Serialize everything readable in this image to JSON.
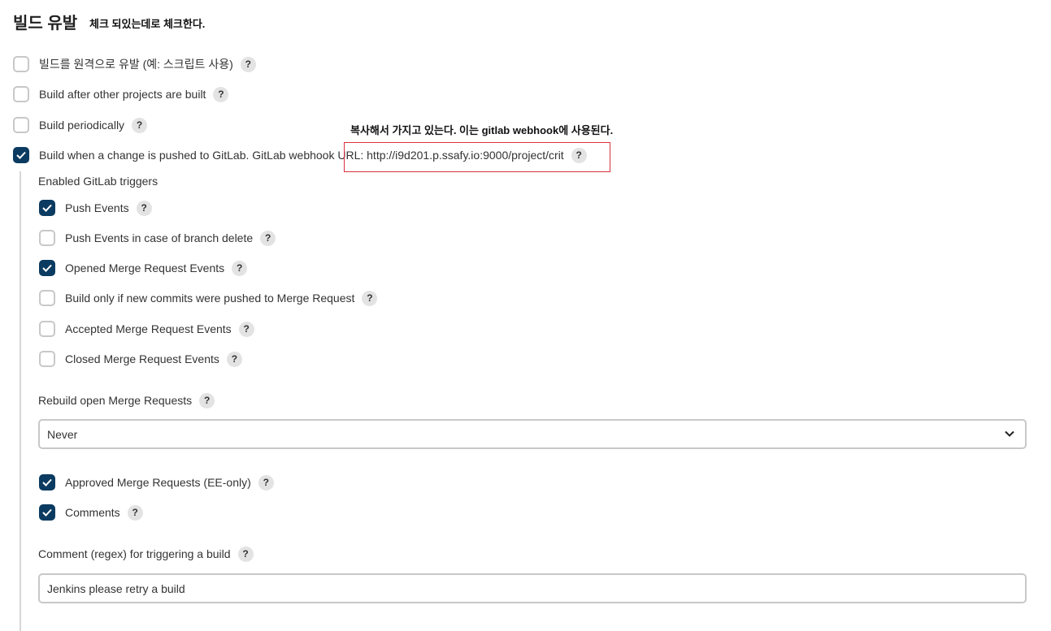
{
  "section": {
    "title": "빌드 유발",
    "annotation_top": "체크 되있는데로 체크한다."
  },
  "annotation_url": "복사해서 가지고 있는다. 이는 gitlab webhook에 사용된다.",
  "help_glyph": "?",
  "triggers": [
    {
      "label": "빌드를 원격으로 유발 (예: 스크립트 사용)",
      "checked": false
    },
    {
      "label": "Build after other projects are built",
      "checked": false
    },
    {
      "label": "Build periodically",
      "checked": false
    },
    {
      "label": "Build when a change is pushed to GitLab. GitLab webhook URL: http://i9d201.p.ssafy.io:9000/project/crit",
      "checked": true
    }
  ],
  "gitlab": {
    "enabled_triggers_label": "Enabled GitLab triggers",
    "events": [
      {
        "label": "Push Events",
        "checked": true
      },
      {
        "label": "Push Events in case of branch delete",
        "checked": false
      },
      {
        "label": "Opened Merge Request Events",
        "checked": true
      },
      {
        "label": "Build only if new commits were pushed to Merge Request",
        "checked": false
      },
      {
        "label": "Accepted Merge Request Events",
        "checked": false
      },
      {
        "label": "Closed Merge Request Events",
        "checked": false
      }
    ],
    "rebuild_label": "Rebuild open Merge Requests",
    "rebuild_value": "Never",
    "extra": [
      {
        "label": "Approved Merge Requests (EE-only)",
        "checked": true
      },
      {
        "label": "Comments",
        "checked": true
      }
    ],
    "comment_regex_label": "Comment (regex) for triggering a build",
    "comment_regex_value": "Jenkins please retry a build"
  },
  "colors": {
    "checked": "#0b3b60",
    "highlight_box": "#d9303e"
  }
}
